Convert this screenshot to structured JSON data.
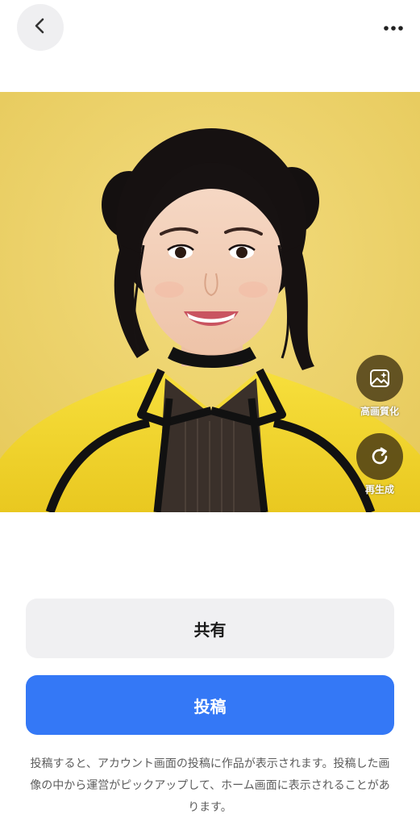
{
  "header": {
    "back_icon": "chevron-left-icon",
    "more_icon": "more-horizontal-icon"
  },
  "image": {
    "alt": "生成された画像",
    "background_color": "#ecd36a"
  },
  "actions": {
    "enhance_label": "高画質化",
    "enhance_icon": "image-sparkle-icon",
    "regenerate_label": "再生成",
    "regenerate_icon": "refresh-icon"
  },
  "buttons": {
    "share_label": "共有",
    "post_label": "投稿"
  },
  "note": "投稿すると、アカウント画面の投稿に作品が表示されます。投稿した画像の中から運営がピックアップして、ホーム画面に表示されることがあります。",
  "colors": {
    "primary": "#3478f6",
    "secondary_button": "#f0f0f2"
  }
}
